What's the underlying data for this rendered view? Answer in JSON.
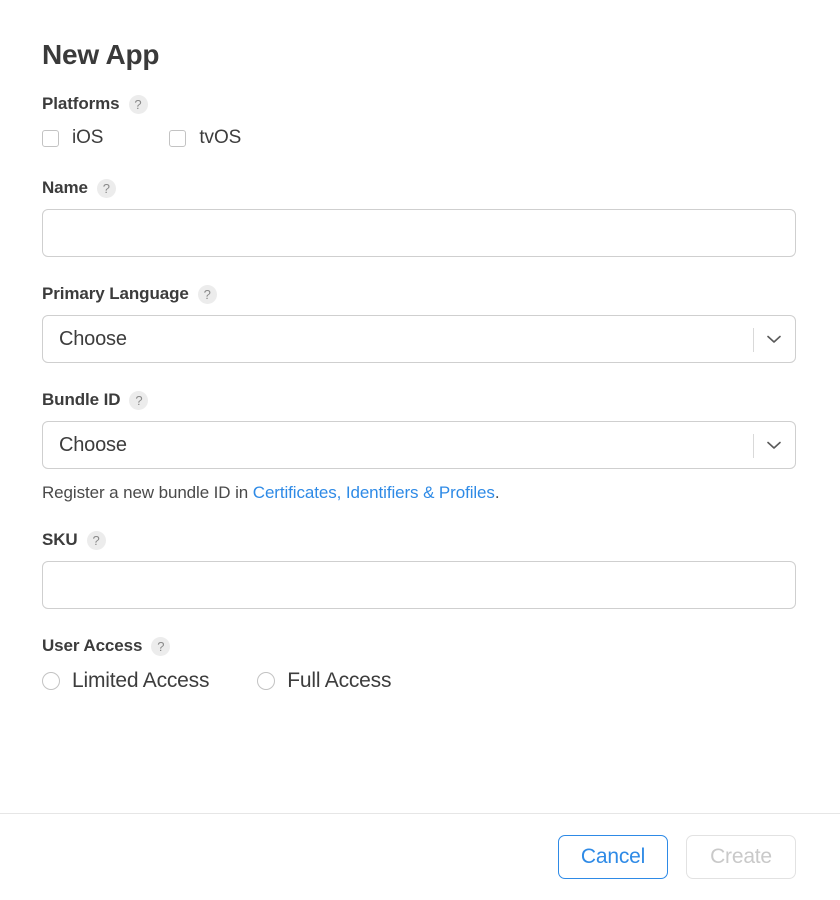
{
  "dialog": {
    "title": "New App"
  },
  "fields": {
    "platforms": {
      "label": "Platforms",
      "help_icon": "help-question-icon",
      "help_glyph": "?",
      "options": [
        {
          "label": "iOS",
          "checked": false
        },
        {
          "label": "tvOS",
          "checked": false
        }
      ]
    },
    "name": {
      "label": "Name",
      "help_glyph": "?",
      "value": "",
      "placeholder": ""
    },
    "primary_language": {
      "label": "Primary Language",
      "help_glyph": "?",
      "value": "Choose",
      "chevron_icon": "chevron-down-icon"
    },
    "bundle_id": {
      "label": "Bundle ID",
      "help_glyph": "?",
      "value": "Choose",
      "chevron_icon": "chevron-down-icon",
      "hint_prefix": "Register a new bundle ID in ",
      "hint_link": "Certificates, Identifiers & Profiles",
      "hint_suffix": "."
    },
    "sku": {
      "label": "SKU",
      "help_glyph": "?",
      "value": "",
      "placeholder": ""
    },
    "user_access": {
      "label": "User Access",
      "help_glyph": "?",
      "options": [
        {
          "label": "Limited Access",
          "selected": false
        },
        {
          "label": "Full Access",
          "selected": false
        }
      ]
    }
  },
  "footer": {
    "cancel_label": "Cancel",
    "create_label": "Create",
    "create_disabled": true
  },
  "colors": {
    "link": "#2e8ae6",
    "accent": "#2e8ae6",
    "text": "#3d3d3d",
    "border": "#cfcfcf",
    "disabled": "#c9c9c9"
  }
}
